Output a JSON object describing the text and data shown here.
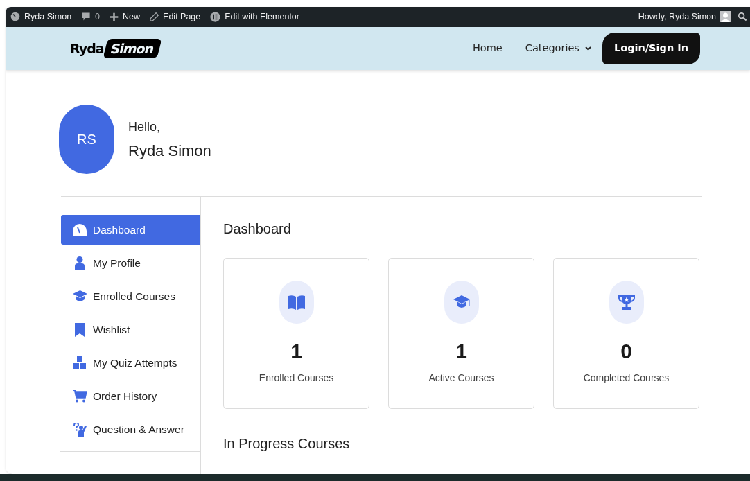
{
  "admin_bar": {
    "site": "Ryda Simon",
    "comments": "0",
    "new": "New",
    "edit_page": "Edit Page",
    "edit_elementor": "Edit with Elementor",
    "greeting": "Howdy, Ryda Simon"
  },
  "header": {
    "logo": [
      "Ryda",
      "Simon"
    ],
    "nav": [
      {
        "label": "Home",
        "dropdown": false
      },
      {
        "label": "Categories",
        "dropdown": true
      }
    ],
    "login": "Login/Sign In"
  },
  "profile": {
    "initials": "RS",
    "hello": "Hello,",
    "name": "Ryda Simon"
  },
  "sidebar": {
    "items": [
      {
        "label": "Dashboard",
        "selected": true
      },
      {
        "label": "My Profile",
        "selected": false
      },
      {
        "label": "Enrolled Courses",
        "selected": false
      },
      {
        "label": "Wishlist",
        "selected": false
      },
      {
        "label": "My Quiz Attempts",
        "selected": false
      },
      {
        "label": "Order History",
        "selected": false
      },
      {
        "label": "Question & Answer",
        "selected": false
      }
    ]
  },
  "content": {
    "title": "Dashboard",
    "cards": [
      {
        "value": "1",
        "label": "Enrolled Courses"
      },
      {
        "value": "1",
        "label": "Active Courses"
      },
      {
        "value": "0",
        "label": "Completed Courses"
      }
    ],
    "section": "In Progress Courses"
  }
}
